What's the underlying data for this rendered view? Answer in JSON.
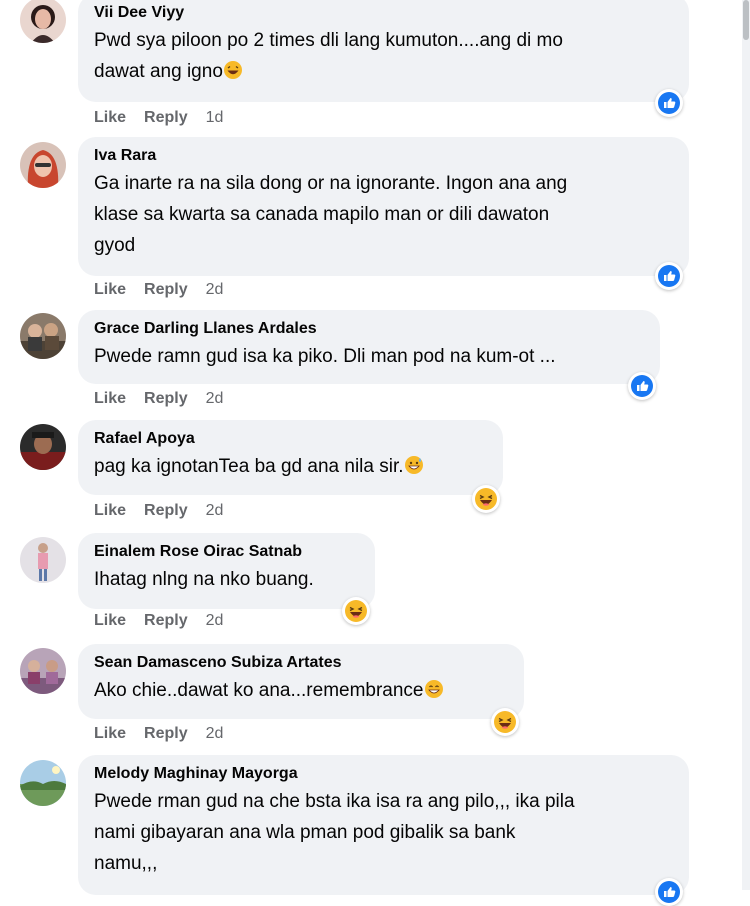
{
  "actions": {
    "like": "Like",
    "reply": "Reply"
  },
  "colors": {
    "bubble": "#f0f2f5",
    "meta_text": "#65676b",
    "like_blue": "#1877f2",
    "haha_yellow": "#f7b928"
  },
  "comments": [
    {
      "author": "Vii Dee Viyy",
      "lines": [
        "Pwd sya piloon po 2 times dli lang kumuton....ang di mo",
        "dawat ang igno"
      ],
      "inline_emoji": "laughing-face-icon",
      "time": "1d",
      "reaction": "like-reaction-icon"
    },
    {
      "author": "Iva Rara",
      "lines": [
        "Ga inarte ra na sila dong or na ignorante. Ingon ana ang",
        "klase sa kwarta sa canada mapilo man or dili dawaton",
        "gyod"
      ],
      "time": "2d",
      "reaction": "like-reaction-icon"
    },
    {
      "author": "Grace Darling Llanes Ardales",
      "lines": [
        "Pwede ramn gud isa ka piko. Dli man pod na kum-ot ..."
      ],
      "time": "2d",
      "reaction": "like-reaction-icon"
    },
    {
      "author": "Rafael Apoya",
      "lines": [
        "pag ka ignotanTea ba gd ana nila sir."
      ],
      "inline_emoji": "grinning-sweat-icon",
      "time": "2d",
      "reaction": "haha-reaction-icon"
    },
    {
      "author": "Einalem Rose Oirac Satnab",
      "lines": [
        "Ihatag nlng na nko buang."
      ],
      "time": "2d",
      "reaction": "haha-reaction-icon"
    },
    {
      "author": "Sean Damasceno Subiza Artates",
      "lines": [
        "Ako chie..dawat ko ana...remembrance"
      ],
      "inline_emoji": "grinning-face-icon",
      "time": "2d",
      "reaction": "haha-reaction-icon"
    },
    {
      "author": "Melody Maghinay Mayorga",
      "lines": [
        "Pwede rman gud na che bsta ika isa ra ang pilo,,, ika pila",
        "nami gibayaran ana wla pman pod gibalik sa bank",
        "namu,,,"
      ],
      "reaction": "like-reaction-icon"
    }
  ]
}
